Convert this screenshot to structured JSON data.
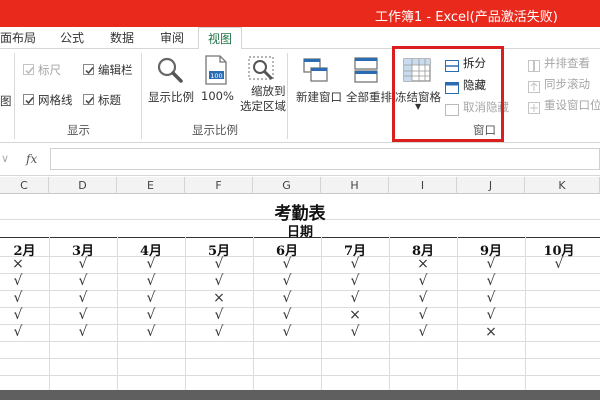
{
  "titlebar": {
    "title": "工作簿1 - Excel(产品激活失败)"
  },
  "tabs": [
    {
      "label": "面布局"
    },
    {
      "label": "公式"
    },
    {
      "label": "数据"
    },
    {
      "label": "审阅"
    },
    {
      "label": "视图",
      "active": true
    }
  ],
  "ribbon": {
    "show_group": {
      "label": "显示",
      "left_fragment": "图",
      "checkboxes": [
        {
          "label": "标尺",
          "checked": true,
          "disabled": true
        },
        {
          "label": "编辑栏",
          "checked": true
        },
        {
          "label": "网格线",
          "checked": true
        },
        {
          "label": "标题",
          "checked": true
        }
      ]
    },
    "zoom_group": {
      "label": "显示比例",
      "buttons": [
        {
          "label": "显示比例",
          "icon": "magnifier-icon"
        },
        {
          "label": "100%",
          "icon": "page-100-icon"
        },
        {
          "label": "缩放到",
          "label2": "选定区域",
          "icon": "zoom-selection-icon"
        }
      ]
    },
    "window_group": {
      "label": "窗口",
      "buttons": [
        {
          "label": "新建窗口",
          "icon": "new-window-icon"
        },
        {
          "label": "全部重排",
          "icon": "arrange-all-icon"
        },
        {
          "label": "冻结窗格",
          "icon": "freeze-panes-icon"
        }
      ],
      "small_buttons": [
        {
          "label": "拆分",
          "icon": "split-icon",
          "disabled": false
        },
        {
          "label": "隐藏",
          "icon": "hide-icon",
          "disabled": false
        },
        {
          "label": "取消隐藏",
          "icon": "unhide-icon",
          "disabled": true
        }
      ],
      "side_buttons": [
        {
          "label": "并排查看",
          "icon": "side-by-side-icon"
        },
        {
          "label": "同步滚动",
          "icon": "sync-scroll-icon"
        },
        {
          "label": "重设窗口位",
          "icon": "reset-window-icon"
        }
      ]
    }
  },
  "formula_bar": {
    "fx_label": "fx",
    "value": ""
  },
  "column_headers": [
    "C",
    "D",
    "E",
    "F",
    "G",
    "H",
    "I",
    "J",
    "K"
  ],
  "sheet": {
    "title": "考勤表",
    "subtitle": "日期",
    "months": [
      "2月",
      "3月",
      "4月",
      "5月",
      "6月",
      "7月",
      "8月",
      "9月",
      "10月"
    ],
    "rows": [
      [
        "×",
        "√",
        "√",
        "√",
        "√",
        "√",
        "×",
        "√",
        "√"
      ],
      [
        "√",
        "√",
        "√",
        "√",
        "√",
        "√",
        "√",
        "√",
        ""
      ],
      [
        "√",
        "√",
        "√",
        "×",
        "√",
        "√",
        "√",
        "√",
        ""
      ],
      [
        "√",
        "√",
        "√",
        "√",
        "√",
        "×",
        "√",
        "√",
        ""
      ],
      [
        "√",
        "√",
        "√",
        "√",
        "√",
        "√",
        "√",
        "×",
        ""
      ]
    ]
  }
}
